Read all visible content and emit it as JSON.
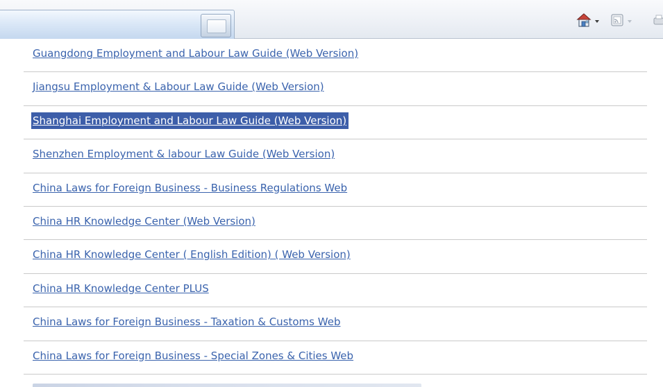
{
  "toolbar": {
    "icons": [
      "home-icon",
      "feeds-icon",
      "print-icon"
    ]
  },
  "links": [
    {
      "label": "Guangdong Employment and Labour Law Guide (Web Version)",
      "selected": false
    },
    {
      "label": "Jiangsu Employment & Labour Law Guide (Web Version)",
      "selected": false
    },
    {
      "label": "Shanghai Employment and Labour Law Guide (Web Version)",
      "selected": true
    },
    {
      "label": "Shenzhen Employment & labour Law Guide (Web Version)",
      "selected": false
    },
    {
      "label": "China Laws for Foreign Business - Business Regulations Web",
      "selected": false
    },
    {
      "label": "China HR Knowledge Center (Web Version)",
      "selected": false
    },
    {
      "label": "China HR Knowledge Center ( English Edition) ( Web Version)",
      "selected": false
    },
    {
      "label": "China HR Knowledge Center PLUS",
      "selected": false
    },
    {
      "label": "China Laws for Foreign Business - Taxation & Customs Web",
      "selected": false
    },
    {
      "label": "China Laws for Foreign Business - Special Zones & Cities Web",
      "selected": false
    }
  ],
  "colors": {
    "link": "#3a63ad",
    "selection": "#3d5ea9",
    "divider": "#c9c9c9"
  }
}
